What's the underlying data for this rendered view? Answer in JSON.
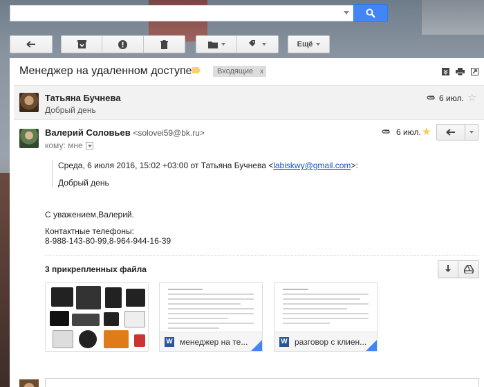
{
  "search": {
    "value": "",
    "placeholder": ""
  },
  "toolbar": {
    "back": "back-arrow-icon",
    "archive": "archive-icon",
    "spam": "report-spam-icon",
    "delete": "trash-icon",
    "move": "folder-icon",
    "labels": "label-icon",
    "more_label": "Ещё"
  },
  "thread": {
    "subject": "Менеджер на удаленном доступе",
    "label_color": "#fad165",
    "inbox_chip": "Входящие",
    "inbox_chip_close": "x"
  },
  "messages": [
    {
      "sender": "Татьяна Бучнева",
      "snippet": "Добрый день",
      "date": "6 июл.",
      "starred": false
    },
    {
      "sender": "Валерий Соловьев",
      "email": "<solovei59@bk.ru>",
      "to_label": "кому: мне",
      "date": "6 июл.",
      "starred": true
    }
  ],
  "quote": {
    "header_prefix": "Среда, 6 июля 2016, 15:02 +03:00 от Татьяна Бучнева <",
    "header_link": "labiskwy@gmail.com",
    "header_suffix": ">:",
    "body": "Добрый день"
  },
  "body": {
    "regards": "С уважением,Валерий.",
    "phones_label": "Контактные телефоны:",
    "phones": "8-988-143-80-99,8-964-944-16-39"
  },
  "attachments": {
    "title": "3 прикрепленных файла",
    "files": [
      {
        "name": "",
        "type": "image"
      },
      {
        "name": "менеджер на те...",
        "type": "word"
      },
      {
        "name": "разговор с клиен...",
        "type": "word"
      }
    ],
    "word_letter": "W"
  },
  "colors": {
    "accent": "#4285f4",
    "star": "#f7cb4d",
    "link": "#1155cc"
  }
}
